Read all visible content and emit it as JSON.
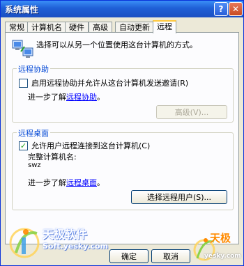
{
  "window": {
    "title": "系统属性",
    "help_button": "?",
    "close_button": "✕"
  },
  "tabs": [
    {
      "label": "常规"
    },
    {
      "label": "计算机名"
    },
    {
      "label": "硬件"
    },
    {
      "label": "高级"
    },
    {
      "label": "自动更新"
    },
    {
      "label": "远程",
      "active": true
    }
  ],
  "intro_text": "选择可以从另一个位置使用这台计算机的方式。",
  "remote_assistance": {
    "group_title": "远程协助",
    "checkbox_label": "启用远程协助并允许从这台计算机发送邀请(R)",
    "checked": false,
    "learn_more_prefix": "进一步了解",
    "learn_more_link": "远程协助",
    "learn_more_suffix": "。",
    "advanced_button": "高级(V)..."
  },
  "remote_desktop": {
    "group_title": "远程桌面",
    "checkbox_label": "允许用户远程连接到这台计算机(C)",
    "checked": true,
    "full_name_label": "完整计算机名:",
    "computer_name": "swz",
    "learn_more_prefix": "进一步了解",
    "learn_more_link": "远程桌面",
    "learn_more_suffix": "。",
    "select_users_button": "选择远程用户(S)..."
  },
  "footer": {
    "ok_button": "确定",
    "cancel_button": "取消"
  },
  "watermarks": {
    "left_brand": "天极软件",
    "left_url": "Soft.yesky.com",
    "right_brand": "天极",
    "right_url": "yesky.com"
  },
  "colors": {
    "titlebar": "#1f5fd6",
    "group_title": "#0046d5",
    "link": "#0000ff",
    "active_tab_accent": "#ffc83c"
  }
}
